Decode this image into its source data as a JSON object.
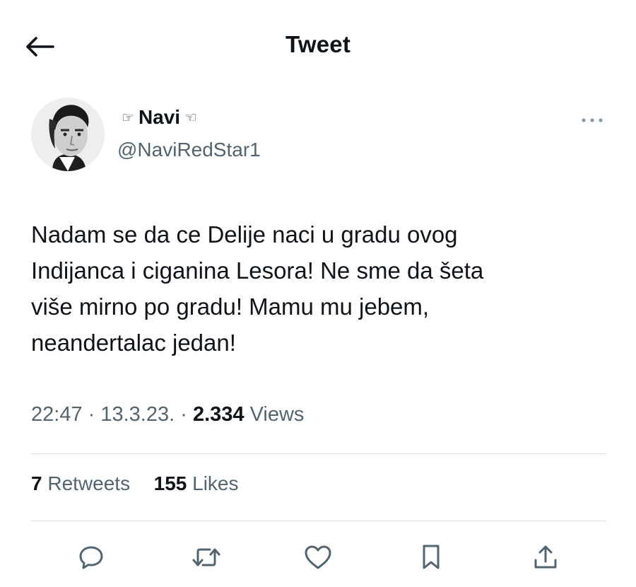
{
  "header": {
    "title": "Tweet",
    "back_icon": "arrow-left-icon"
  },
  "author": {
    "hand_left": "☞",
    "name": "Navi",
    "hand_right": "☜",
    "handle": "@NaviRedStar1",
    "more_icon": "more-horizontal-icon"
  },
  "tweet": {
    "lines": [
      "Nadam se da ce Delije naci u gradu ovog",
      "Indijanca i ciganina Lesora! Ne sme da šeta",
      "više mirno po gradu! Mamu mu jebem,",
      "neandertalac jedan!"
    ]
  },
  "meta": {
    "time": "22:47",
    "sep1": " · ",
    "date": "13.3.23.",
    "sep2": " · ",
    "views_count": "2.334",
    "views_label": " Views"
  },
  "stats": {
    "retweets_count": "7",
    "retweets_label": " Retweets",
    "likes_count": "155",
    "likes_label": " Likes"
  },
  "actions": {
    "reply_icon": "reply-icon",
    "retweet_icon": "retweet-icon",
    "like_icon": "heart-icon",
    "bookmark_icon": "bookmark-icon",
    "share_icon": "share-icon"
  },
  "colors": {
    "text": "#0f1419",
    "secondary": "#536471",
    "divider": "#d8dde1"
  }
}
